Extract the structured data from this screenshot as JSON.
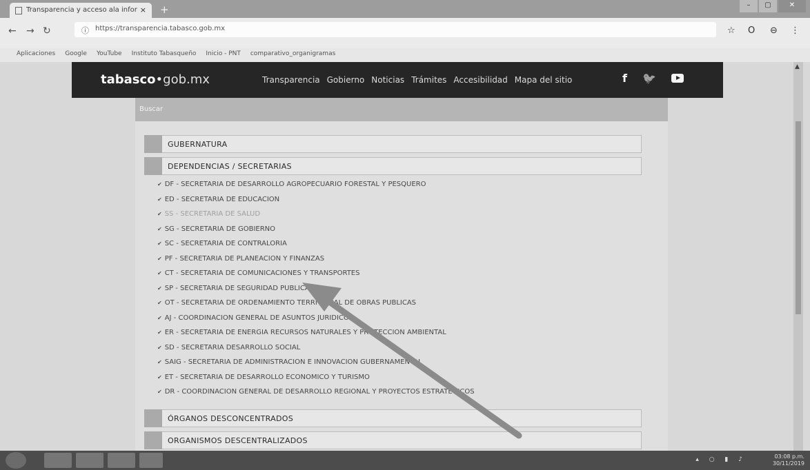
{
  "browser": {
    "tab_title": "Transparencia y acceso ala infor",
    "tab_close": "×",
    "new_tab": "+",
    "url": "https://transparencia.tabasco.gob.mx",
    "bookmarks": [
      "Aplicaciones",
      "Google",
      "YouTube",
      "Instituto Tabasqueño",
      "Inicio - PNT",
      "comparativo_organigramas"
    ]
  },
  "site": {
    "logo_bold": "tabasco",
    "logo_dot": "•",
    "logo_light": "gob.mx",
    "nav": [
      "Transparencia",
      "Gobierno",
      "Noticias",
      "Trámites",
      "Accesibilidad",
      "Mapa del sitio"
    ],
    "social": {
      "facebook": "f",
      "twitter": "🐦"
    },
    "search_placeholder": "Buscar"
  },
  "sections": {
    "gubernatura": "GUBERNATURA",
    "dependencias": "DEPENDENCIAS / SECRETARIAS",
    "organos": "ÓRGANOS DESCONCENTRADOS",
    "organismos": "ORGANISMOS DESCENTRALIZADOS"
  },
  "dependencias": [
    "DF - SECRETARIA DE DESARROLLO AGROPECUARIO FORESTAL Y PESQUERO",
    "ED - SECRETARIA DE EDUCACION",
    "SS - SECRETARIA DE SALUD",
    "SG - SECRETARIA DE GOBIERNO",
    "SC - SECRETARIA DE CONTRALORIA",
    "PF - SECRETARIA DE PLANEACION Y FINANZAS",
    "CT - SECRETARIA DE COMUNICACIONES Y TRANSPORTES",
    "SP - SECRETARIA DE SEGURIDAD PUBLICA",
    "OT - SECRETARIA DE ORDENAMIENTO TERRITORIAL DE OBRAS PUBLICAS",
    "AJ - COORDINACION GENERAL DE ASUNTOS JURIDICOS",
    "ER - SECRETARIA DE ENERGIA RECURSOS NATURALES Y PROTECCION AMBIENTAL",
    "SD - SECRETARIA DESARROLLO SOCIAL",
    "SAIG - SECRETARIA DE ADMINISTRACION E INNOVACION GUBERNAMENTAL",
    "ET - SECRETARIA DE DESARROLLO ECONOMICO Y TURISMO",
    "DR - COORDINACION GENERAL DE DESARROLLO REGIONAL Y PROYECTOS ESTRATEGICOS"
  ],
  "taskbar": {
    "time": "03:08 p.m.",
    "date": "30/11/2019"
  },
  "colors": {
    "header_bg": "#2a2a2a",
    "arrow": "#8a8a8a"
  }
}
